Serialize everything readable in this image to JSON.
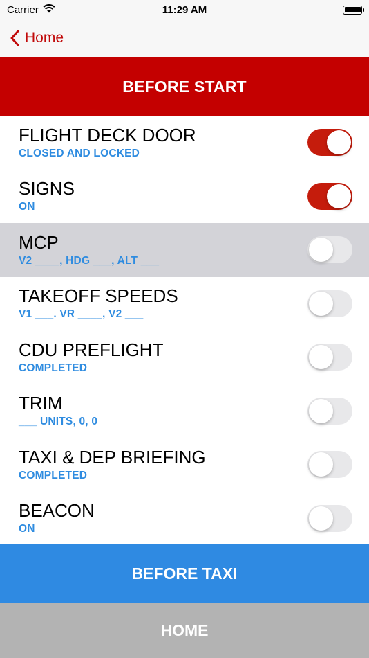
{
  "status_bar": {
    "carrier": "Carrier",
    "time": "11:29 AM"
  },
  "nav": {
    "back_label": "Home"
  },
  "section": {
    "title": "BEFORE START"
  },
  "items": [
    {
      "title": "FLIGHT DECK DOOR",
      "subtitle": "CLOSED AND LOCKED",
      "checked": true
    },
    {
      "title": "SIGNS",
      "subtitle": "ON",
      "checked": true
    },
    {
      "title": "MCP",
      "subtitle": "V2 ____, HDG ___, ALT ___",
      "checked": false,
      "highlighted": true
    },
    {
      "title": "TAKEOFF SPEEDS",
      "subtitle": "V1 ___. VR ____, V2 ___",
      "checked": false
    },
    {
      "title": "CDU PREFLIGHT",
      "subtitle": "COMPLETED",
      "checked": false
    },
    {
      "title": "TRIM",
      "subtitle": "___ UNITS, 0, 0",
      "checked": false
    },
    {
      "title": "TAXI & DEP BRIEFING",
      "subtitle": "COMPLETED",
      "checked": false
    },
    {
      "title": "BEACON",
      "subtitle": "ON",
      "checked": false
    }
  ],
  "buttons": {
    "next_label": "BEFORE TAXI",
    "home_label": "HOME"
  },
  "colors": {
    "accent_red": "#c40000",
    "toggle_on": "#c51c0c",
    "subtitle_blue": "#2f8ce0",
    "next_button": "#2f8ae2",
    "home_button": "#b3b3b3"
  }
}
